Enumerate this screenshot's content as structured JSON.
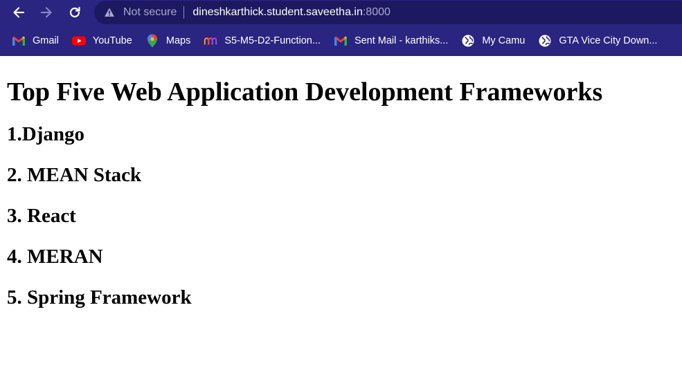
{
  "browser": {
    "security_label": "Not secure",
    "url_host": "dineshkarthick.student.saveetha.in",
    "url_port": ":8000",
    "icons": {
      "back": "arrow-left-icon",
      "forward": "arrow-right-icon",
      "reload": "reload-icon",
      "security": "warning-triangle-icon"
    },
    "colors": {
      "chrome_bg": "#2a2580",
      "omnibox_bg": "#1d1960"
    }
  },
  "bookmarks": [
    {
      "label": "Gmail",
      "icon": "gmail-icon"
    },
    {
      "label": "YouTube",
      "icon": "youtube-icon"
    },
    {
      "label": "Maps",
      "icon": "maps-pin-icon"
    },
    {
      "label": "S5-M5-D2-Function...",
      "icon": "bookmark-logo-icon"
    },
    {
      "label": "Sent Mail - karthiks...",
      "icon": "gmail-icon"
    },
    {
      "label": "My Camu",
      "icon": "globe-icon"
    },
    {
      "label": "GTA Vice City Down...",
      "icon": "globe-icon"
    }
  ],
  "page": {
    "heading": "Top Five Web Application Development Frameworks",
    "items": [
      "1.Django",
      "2. MEAN Stack",
      "3. React",
      "4. MERAN",
      "5. Spring Framework"
    ]
  }
}
